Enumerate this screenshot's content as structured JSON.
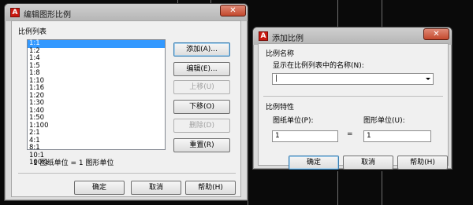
{
  "edit_dialog": {
    "title": "编辑图形比例",
    "close_glyph": "✕",
    "group_label": "比例列表",
    "scales": [
      "1:1",
      "1:2",
      "1:4",
      "1:5",
      "1:8",
      "1:10",
      "1:16",
      "1:20",
      "1:30",
      "1:40",
      "1:50",
      "1:100",
      "2:1",
      "4:1",
      "8:1",
      "10:1",
      "100:1"
    ],
    "selected_index": 0,
    "buttons": {
      "add": "添加(A)...",
      "edit": "编辑(E)...",
      "move_up": "上移(U)",
      "move_down": "下移(O)",
      "delete": "删除(D)",
      "reset": "重置(R)"
    },
    "status": "1 图纸单位 = 1 图形单位",
    "footer": {
      "ok": "确定",
      "cancel": "取消",
      "help": "帮助(H)"
    }
  },
  "add_dialog": {
    "title": "添加比例",
    "close_glyph": "✕",
    "name_group": "比例名称",
    "name_prompt": "显示在比例列表中的名称(N):",
    "name_value": "",
    "props_group": "比例特性",
    "paper_units_label": "图纸单位(P):",
    "paper_units_value": "1",
    "equals": "=",
    "drawing_units_label": "图形单位(U):",
    "drawing_units_value": "1",
    "footer": {
      "ok": "确定",
      "cancel": "取消",
      "help": "帮助(H)"
    }
  }
}
